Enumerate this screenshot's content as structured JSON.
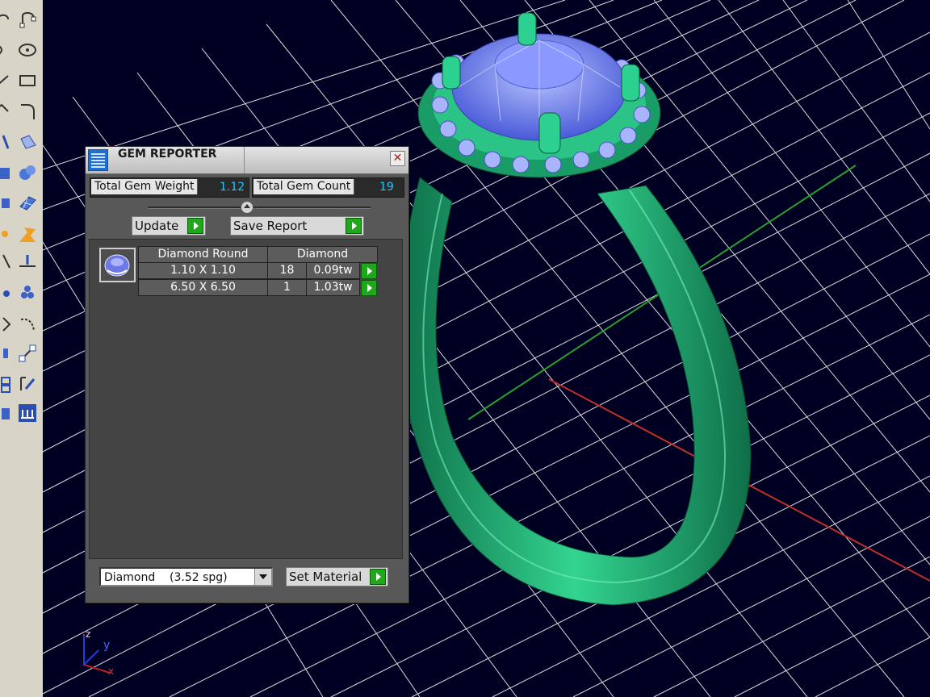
{
  "panel": {
    "title": "GEM REPORTER",
    "close_glyph": "✕",
    "icon": "report-icon"
  },
  "stats": {
    "weight_label": "Total Gem Weight",
    "weight_value": "1.12",
    "count_label": "Total Gem Count",
    "count_value": "19"
  },
  "buttons": {
    "update": "Update",
    "save_report": "Save Report",
    "set_material": "Set Material"
  },
  "gem_table": {
    "header_shape": "Diamond Round",
    "header_material": "Diamond",
    "rows": [
      {
        "size": "1.10 X 1.10",
        "count": "18",
        "weight": "0.09tw"
      },
      {
        "size": "6.50 X 6.50",
        "count": "1",
        "weight": "1.03tw"
      }
    ]
  },
  "material": {
    "selected": "Diamond    (3.52 spg)"
  },
  "axis": {
    "z": "z",
    "y": "y",
    "x": "x"
  },
  "colors": {
    "viewport_bg": "#000022",
    "ring_green": "#1fa86e",
    "gem_blue": "#7d8cf0",
    "value_cyan": "#1ec8ff",
    "play_green": "#1fa81a"
  }
}
